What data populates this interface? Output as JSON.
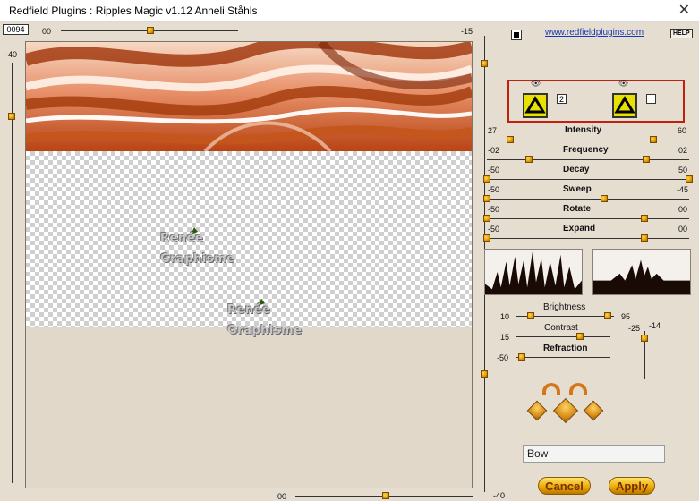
{
  "window": {
    "title": "Redfield Plugins : Ripples Magic v1.12   Anneli Ståhls",
    "close": "✕"
  },
  "top": {
    "value_box": "0094",
    "left_slider_min": "00",
    "right_value": "-15",
    "left_vertical_value": "-40"
  },
  "link": "www.redfieldplugins.com",
  "help": "HELP",
  "layers": {
    "number_box": "2"
  },
  "watermark": {
    "line1": "Renée",
    "line2": "Graphisme"
  },
  "sliders": {
    "intensity": {
      "label": "Intensity",
      "left": "27",
      "right": "60"
    },
    "frequency": {
      "label": "Frequency",
      "left": "-02",
      "right": "02"
    },
    "decay": {
      "label": "Decay",
      "left": "-50",
      "right": "50"
    },
    "sweep": {
      "label": "Sweep",
      "left": "-50",
      "right": "-45"
    },
    "rotate": {
      "label": "Rotate",
      "left": "-50",
      "right": "00"
    },
    "expand": {
      "label": "Expand",
      "left": "-50",
      "right": "00"
    }
  },
  "brightness": {
    "label": "Brightness",
    "left": "10",
    "right": "95"
  },
  "contrast": {
    "label": "Contrast",
    "left": "15"
  },
  "refraction": {
    "label": "Refraction",
    "left": "-50"
  },
  "vertical_pair": {
    "left": "-25",
    "right": "-14"
  },
  "bottom": {
    "slider_value": "00",
    "right_value": "-40"
  },
  "dropdown": {
    "selected": "Bow",
    "chevron": "⌵"
  },
  "buttons": {
    "cancel": "Cancel",
    "apply": "Apply"
  }
}
